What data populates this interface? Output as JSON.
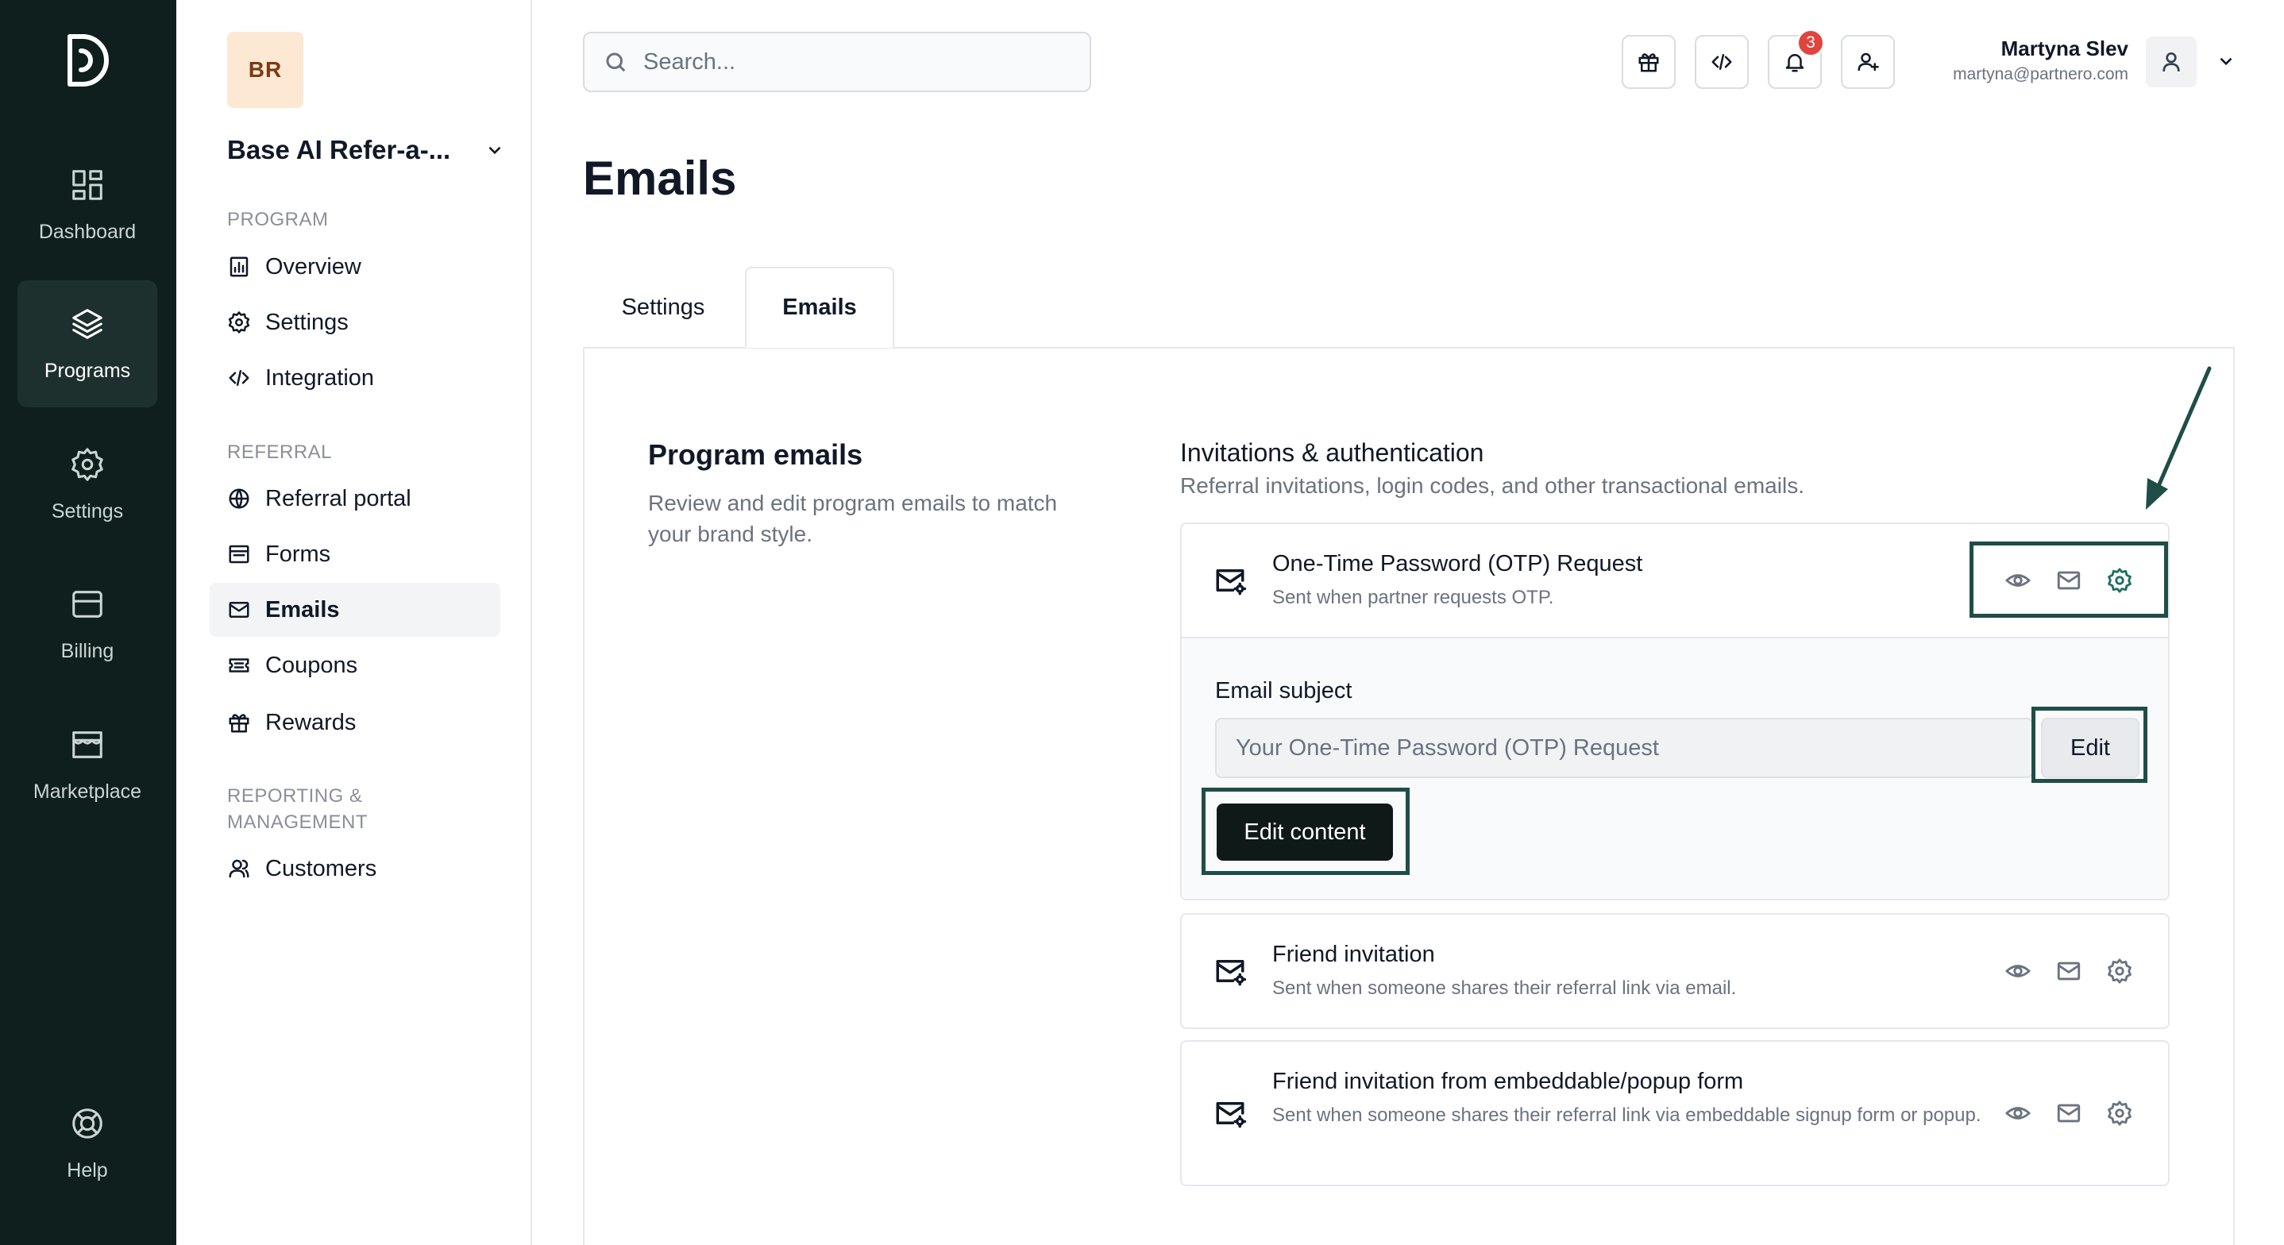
{
  "rail": {
    "items": [
      {
        "label": "Dashboard",
        "icon": "dashboard-icon"
      },
      {
        "label": "Programs",
        "icon": "layers-icon",
        "active": true
      },
      {
        "label": "Settings",
        "icon": "gear-icon"
      },
      {
        "label": "Billing",
        "icon": "billing-icon"
      },
      {
        "label": "Marketplace",
        "icon": "store-icon"
      }
    ],
    "help": {
      "label": "Help",
      "icon": "lifebuoy-icon"
    }
  },
  "sidebar": {
    "org_initials": "BR",
    "org_name": "Base AI Refer-a-...",
    "sections": {
      "program": "PROGRAM",
      "referral": "REFERRAL",
      "reporting": "REPORTING & MANAGEMENT"
    },
    "items": [
      {
        "label": "Overview",
        "icon": "chart-icon"
      },
      {
        "label": "Settings",
        "icon": "gear-icon"
      },
      {
        "label": "Integration",
        "icon": "code-icon"
      },
      {
        "label": "Referral portal",
        "icon": "globe-icon"
      },
      {
        "label": "Forms",
        "icon": "form-icon"
      },
      {
        "label": "Emails",
        "icon": "mail-icon",
        "active": true
      },
      {
        "label": "Coupons",
        "icon": "ticket-icon"
      },
      {
        "label": "Rewards",
        "icon": "gift-icon"
      },
      {
        "label": "Customers",
        "icon": "users-icon"
      }
    ]
  },
  "topbar": {
    "search_placeholder": "Search...",
    "notification_count": "3",
    "user_name": "Martyna Slev",
    "user_email": "martyna@partnero.com"
  },
  "main": {
    "title": "Emails",
    "tabs": [
      {
        "label": "Settings"
      },
      {
        "label": "Emails",
        "active": true
      }
    ],
    "program_emails": {
      "title": "Program emails",
      "description": "Review and edit program emails to match your brand style."
    },
    "group": {
      "title": "Invitations & authentication",
      "description": "Referral invitations, login codes, and other transactional emails."
    },
    "emails": [
      {
        "title": "One-Time Password (OTP) Request",
        "subtitle": "Sent when partner requests OTP.",
        "expanded": true,
        "subject_label": "Email subject",
        "subject_value": "Your One-Time Password (OTP) Request",
        "edit_label": "Edit",
        "edit_content_label": "Edit content"
      },
      {
        "title": "Friend invitation",
        "subtitle": "Sent when someone shares their referral link via email."
      },
      {
        "title": "Friend invitation from embeddable/popup form",
        "subtitle": "Sent when someone shares their referral link via embeddable signup form or popup."
      }
    ]
  },
  "colors": {
    "rail_bg": "#0f1f1d",
    "accent": "#1f6f62",
    "highlight_border": "#1f4d48",
    "badge_red": "#e0443e"
  }
}
